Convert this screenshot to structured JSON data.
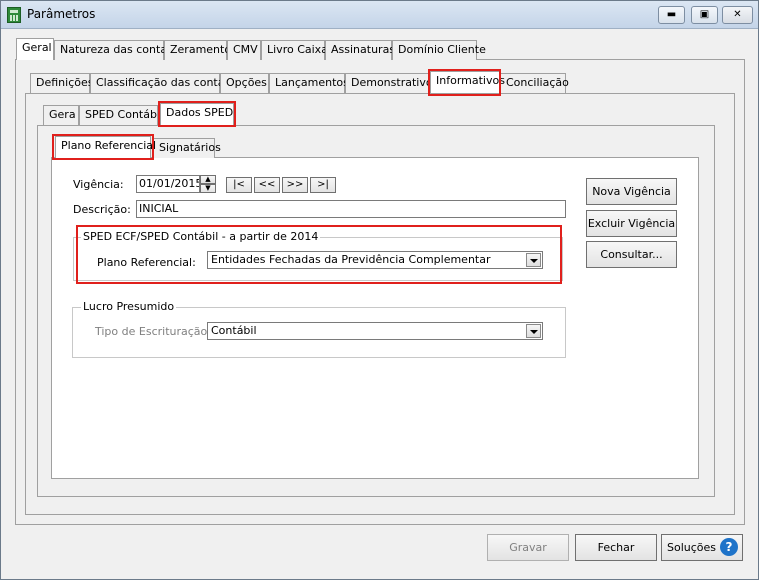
{
  "window": {
    "title": "Parâmetros",
    "icon": "calculator-icon",
    "controls": {
      "minimize": "▬",
      "maximize": "▣",
      "close": "✕"
    }
  },
  "tabs_level1": [
    "Geral",
    "Natureza das contas",
    "Zeramento",
    "CMV",
    "Livro Caixa",
    "Assinaturas",
    "Domínio Cliente"
  ],
  "tabs_level2": [
    "Definições",
    "Classificação das contas",
    "Opções",
    "Lançamentos",
    "Demonstrativos",
    "Informativos",
    "Conciliação"
  ],
  "tabs_level3": [
    "Gera",
    "SPED Contábil",
    "Dados SPED"
  ],
  "tabs_level4": [
    "Plano Referencial",
    "Signatários"
  ],
  "form": {
    "vigencia_label": "Vigência:",
    "vigencia_value": "01/01/2015",
    "nav_buttons": [
      "|<",
      "<<",
      ">>",
      ">|"
    ],
    "descricao_label": "Descrição:",
    "descricao_value": "INICIAL",
    "sped_group_title": "SPED ECF/SPED Contábil - a partir de 2014",
    "plano_label": "Plano Referencial:",
    "plano_value": "Entidades Fechadas da Previdência Complementar",
    "lucro_group_title": "Lucro Presumido",
    "escrituracao_label": "Tipo de Escrituração:",
    "escrituracao_value": "Contábil"
  },
  "side_buttons": {
    "nova": "Nova Vigência",
    "excluir": "Excluir Vigência",
    "consultar": "Consultar..."
  },
  "footer": {
    "gravar": "Gravar",
    "fechar": "Fechar",
    "solucoes": "Soluções",
    "help_icon": "?"
  },
  "colors": {
    "highlight": "#e0201c",
    "help_icon": "#1e73c9"
  }
}
